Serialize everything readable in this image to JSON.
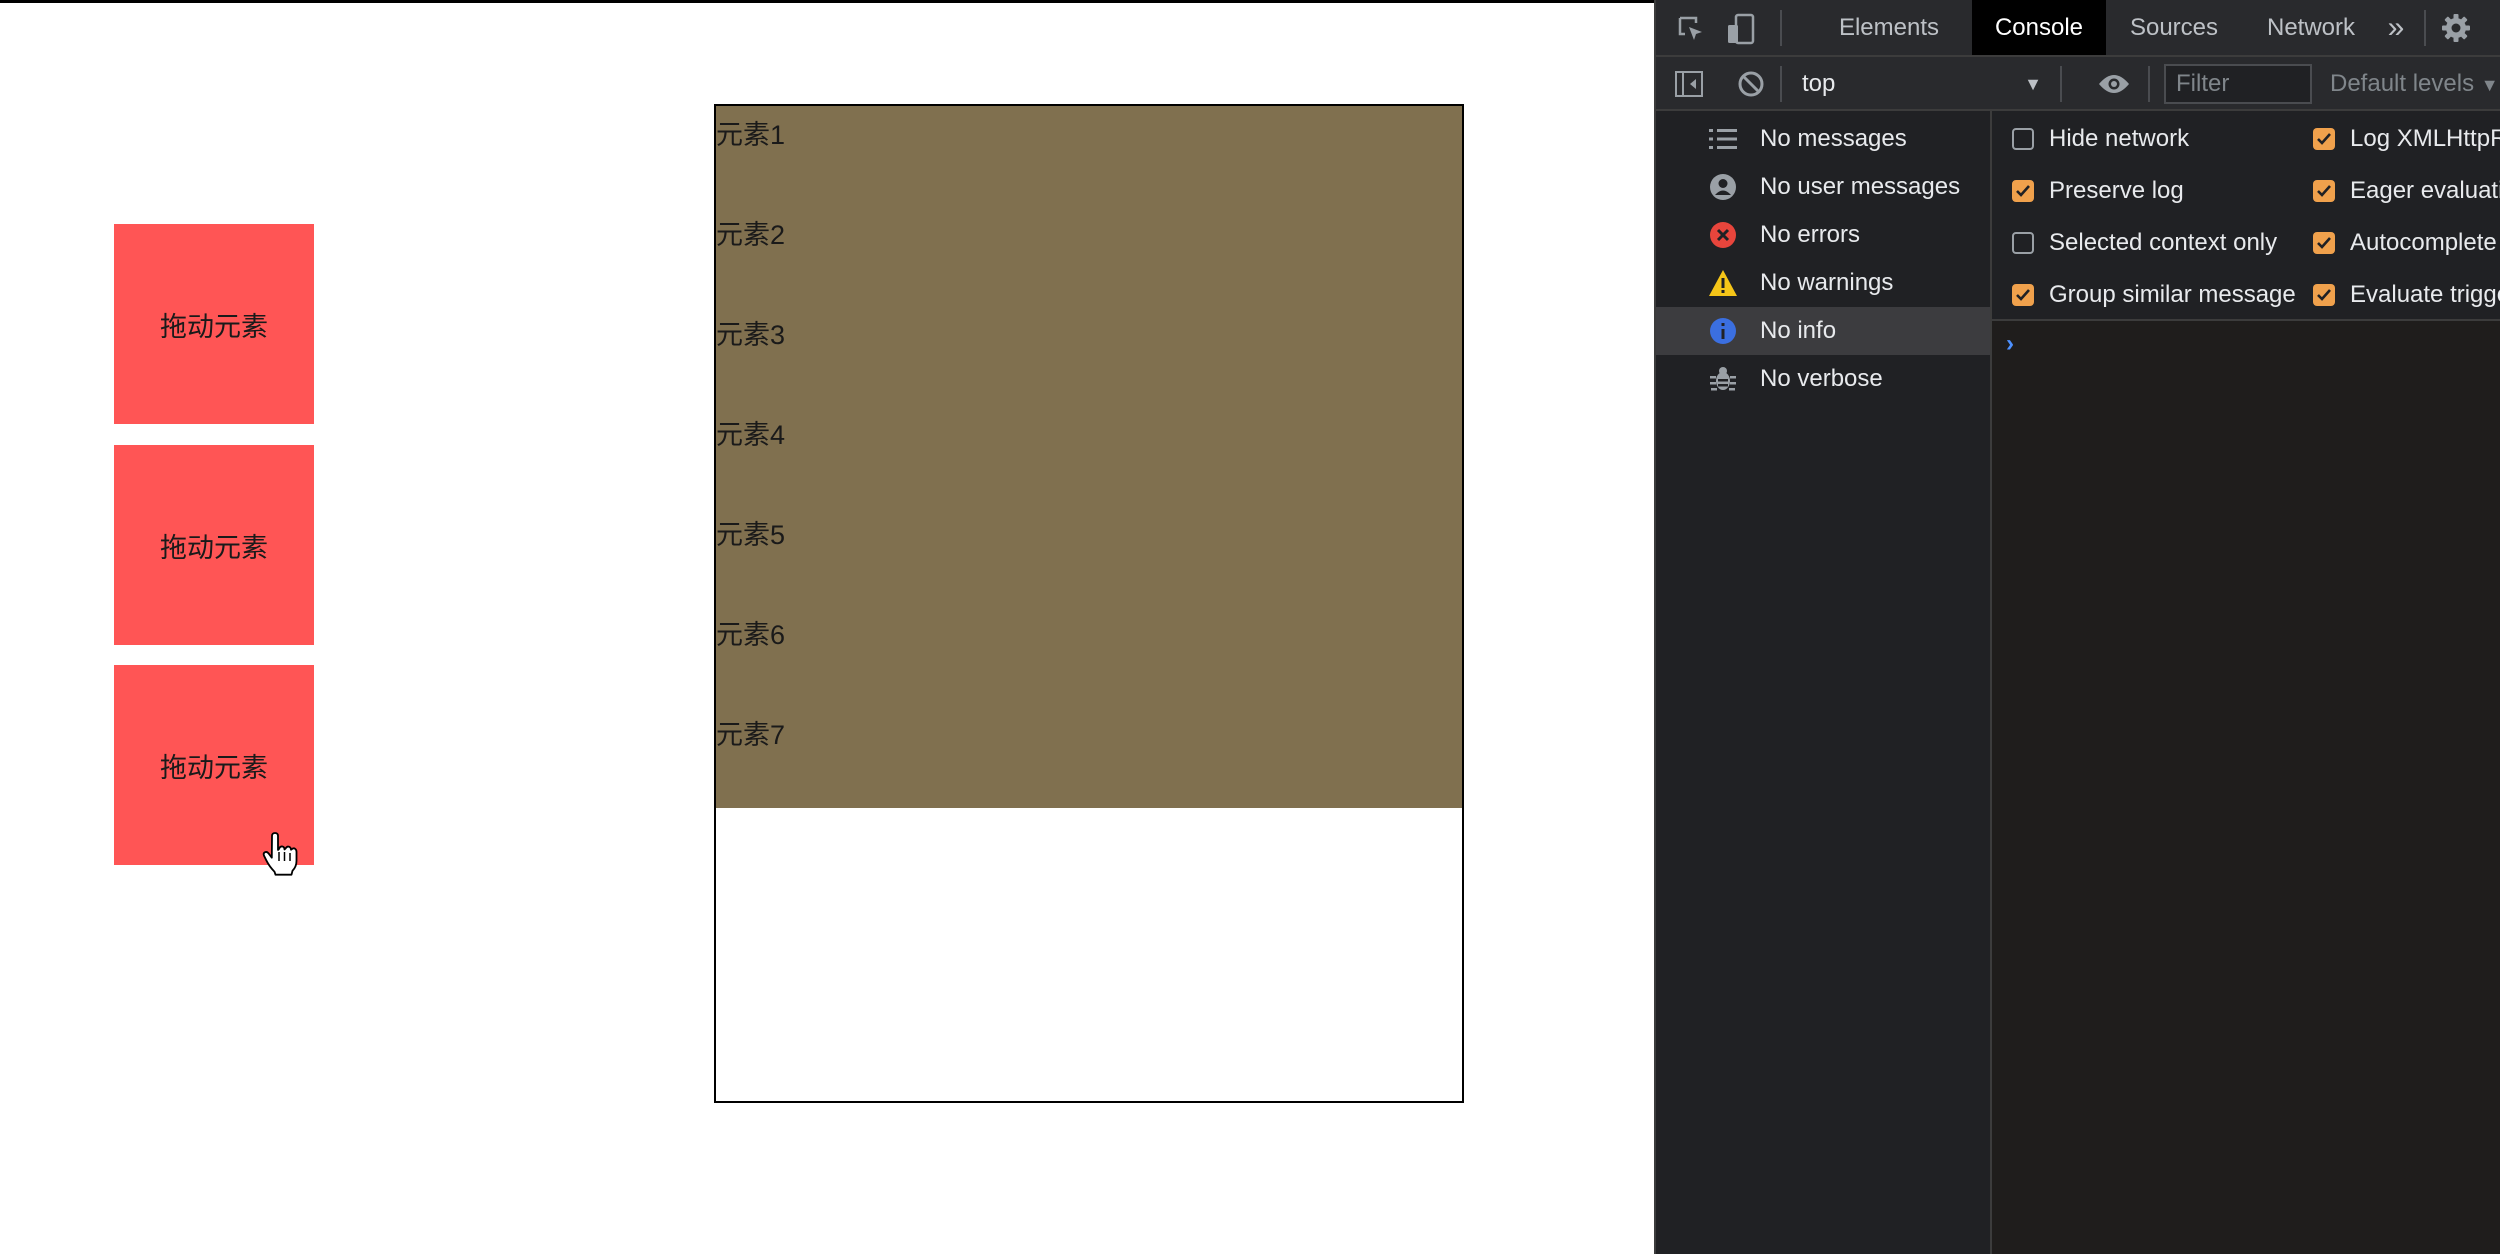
{
  "page": {
    "drag_items": [
      {
        "label": "拖动元素"
      },
      {
        "label": "拖动元素"
      },
      {
        "label": "拖动元素"
      }
    ],
    "drop_zone": {
      "items": [
        "元素1",
        "元素2",
        "元素3",
        "元素4",
        "元素5",
        "元素6",
        "元素7"
      ],
      "fill_color": "#80704f"
    },
    "drag_color": "#ff5555"
  },
  "devtools": {
    "tabs": [
      {
        "label": "Elements",
        "active": false
      },
      {
        "label": "Console",
        "active": true
      },
      {
        "label": "Sources",
        "active": false
      },
      {
        "label": "Network",
        "active": false
      }
    ],
    "more_tabs_icon": "double-chevron-right-icon",
    "settings_icon": "gear-icon",
    "context": "top",
    "filter_placeholder": "Filter",
    "levels_label": "Default levels",
    "sidebar": [
      {
        "label": "No messages",
        "icon": "list-icon",
        "selected": false
      },
      {
        "label": "No user messages",
        "icon": "user-icon",
        "selected": false
      },
      {
        "label": "No errors",
        "icon": "error-icon",
        "selected": false
      },
      {
        "label": "No warnings",
        "icon": "warning-icon",
        "selected": false
      },
      {
        "label": "No info",
        "icon": "info-icon",
        "selected": true
      },
      {
        "label": "No verbose",
        "icon": "bug-icon",
        "selected": false
      }
    ],
    "settings": {
      "left": [
        {
          "label": "Hide network",
          "checked": false
        },
        {
          "label": "Preserve log",
          "checked": true
        },
        {
          "label": "Selected context only",
          "checked": false
        },
        {
          "label": "Group similar message",
          "checked": true
        }
      ],
      "right": [
        {
          "label": "Log XMLHttpR",
          "checked": true
        },
        {
          "label": "Eager evaluatio",
          "checked": true
        },
        {
          "label": "Autocomplete",
          "checked": true
        },
        {
          "label": "Evaluate trigge",
          "checked": true
        }
      ]
    },
    "accent_color": "#f0a14c"
  }
}
